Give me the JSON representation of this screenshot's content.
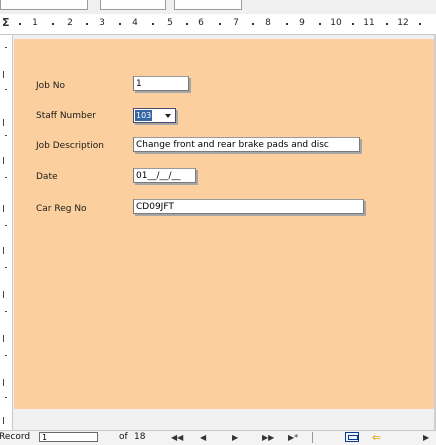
{
  "ruler": {
    "numbers": [
      "1",
      "2",
      "3",
      "4",
      "5",
      "6",
      "7",
      "8",
      "9",
      "10",
      "11",
      "12"
    ]
  },
  "form": {
    "fields": [
      {
        "label": "Job No",
        "value": "1"
      },
      {
        "label": "Staff Number",
        "value": "103"
      },
      {
        "label": "Job Description",
        "value": "Change front and rear brake pads and disc"
      },
      {
        "label": "Date",
        "value": "01__/__/__"
      },
      {
        "label": "Car Reg No",
        "value": "CD09JFT"
      }
    ],
    "background": "#fcd09e"
  },
  "statusbar": {
    "record_label": "Record",
    "record_value": "1",
    "of_label": "of",
    "record_count": "18",
    "nav": {
      "first": "◀◀",
      "prev": "◀",
      "next": "▶",
      "last": "▶▶",
      "new": "▶*"
    },
    "icons": [
      "form-view-icon",
      "back-arrow-icon"
    ]
  }
}
